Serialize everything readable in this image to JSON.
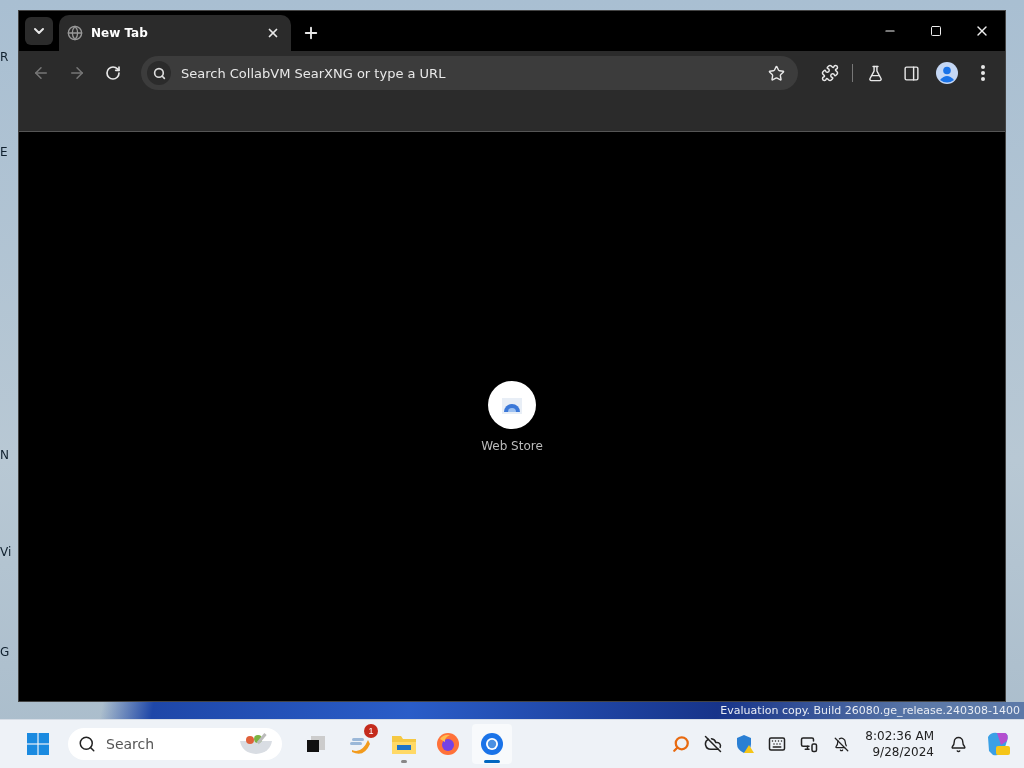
{
  "desktop": {
    "icon_labels": [
      "R",
      "E",
      "N",
      "Vi",
      "G"
    ],
    "watermark_text": "Evaluation copy. Build 26080.ge_release.240308-1400"
  },
  "browser": {
    "tabs": [
      {
        "title": "New Tab",
        "selected": true
      }
    ],
    "omnibox": {
      "placeholder": "Search CollabVM SearXNG or type a URL"
    },
    "shortcuts": [
      {
        "label": "Web Store"
      }
    ]
  },
  "taskbar": {
    "search": {
      "placeholder": "Search"
    },
    "apps": [
      {
        "kind": "taskview",
        "selected": false,
        "running": false
      },
      {
        "kind": "weather",
        "selected": false,
        "running": false,
        "badge": "1"
      },
      {
        "kind": "files",
        "selected": false,
        "running": true
      },
      {
        "kind": "firefox",
        "selected": false,
        "running": false
      },
      {
        "kind": "chrome",
        "selected": true,
        "running": true
      }
    ],
    "clock": {
      "time": "8:02:36 AM",
      "date": "9/28/2024"
    }
  }
}
